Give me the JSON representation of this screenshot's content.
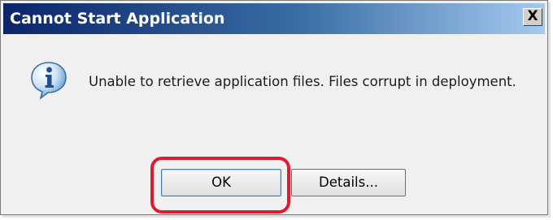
{
  "window": {
    "title": "Cannot Start Application",
    "close_glyph": "X"
  },
  "message": {
    "icon": "info-icon",
    "text": "Unable to retrieve application files. Files corrupt in deployment."
  },
  "buttons": {
    "ok_label": "OK",
    "details_label": "Details..."
  },
  "colors": {
    "title_gradient_start": "#0a246a",
    "title_gradient_end": "#a6caf0",
    "highlight": "#e01a32"
  }
}
